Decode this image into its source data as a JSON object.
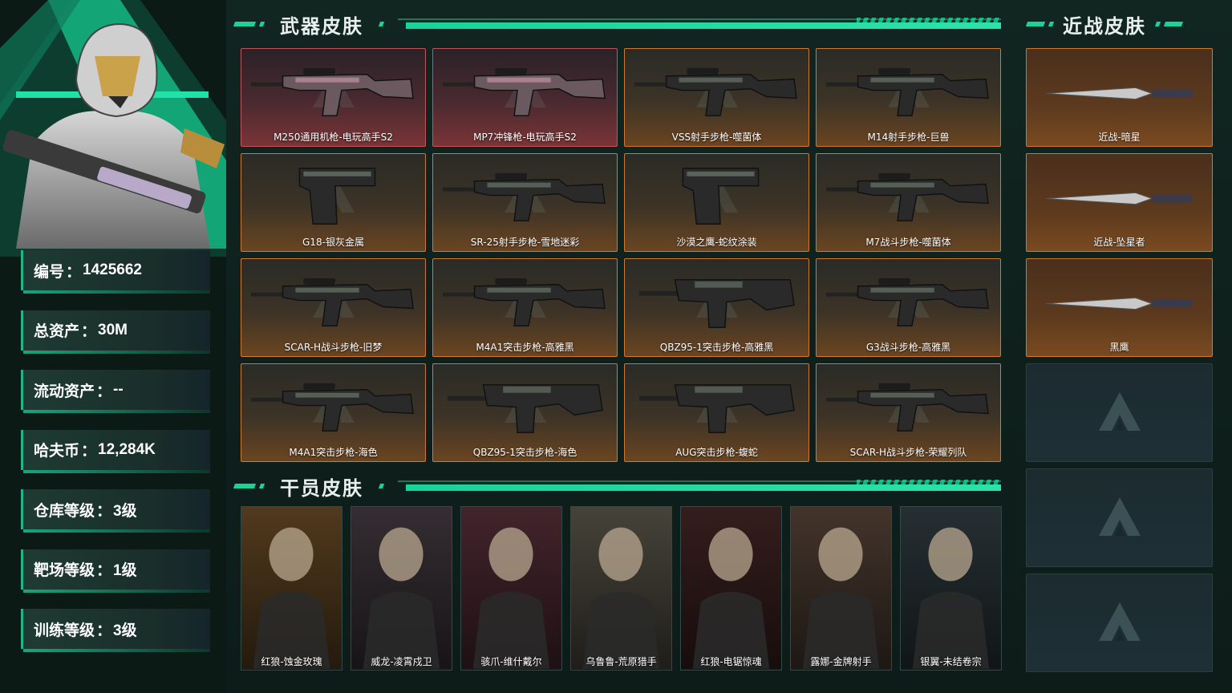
{
  "stats": [
    {
      "label": "编号",
      "value": "1425662"
    },
    {
      "label": "总资产",
      "value": "30M"
    },
    {
      "label": "流动资产",
      "value": "--"
    },
    {
      "label": "哈夫币",
      "value": "12,284K"
    },
    {
      "label": "仓库等级",
      "value": "3级"
    },
    {
      "label": "靶场等级",
      "value": "1级"
    },
    {
      "label": "训练等级",
      "value": "3级"
    }
  ],
  "stat_separator": "：",
  "sections": {
    "weapons_title": "武器皮肤",
    "operators_title": "干员皮肤",
    "melee_title": "近战皮肤"
  },
  "weapons": [
    {
      "name": "M250通用机枪-电玩高手S2",
      "rarity": "red",
      "icon": "lmg-icon"
    },
    {
      "name": "MP7冲锋枪-电玩高手S2",
      "rarity": "red",
      "icon": "smg-icon"
    },
    {
      "name": "VSS射手步枪-噬菌体",
      "rarity": "orange",
      "icon": "marksman-rifle-icon"
    },
    {
      "name": "M14射手步枪-巨兽",
      "rarity": "orange",
      "icon": "marksman-rifle-icon"
    },
    {
      "name": "G18-银灰金属",
      "rarity": "orange",
      "icon": "pistol-icon"
    },
    {
      "name": "SR-25射手步枪-雪地迷彩",
      "rarity": "orange",
      "icon": "marksman-rifle-icon"
    },
    {
      "name": "沙漠之鹰-蛇纹涂装",
      "rarity": "orange",
      "icon": "pistol-icon"
    },
    {
      "name": "M7战斗步枪-噬菌体",
      "rarity": "orange",
      "icon": "battle-rifle-icon"
    },
    {
      "name": "SCAR-H战斗步枪-旧梦",
      "rarity": "orange",
      "icon": "battle-rifle-icon"
    },
    {
      "name": "M4A1突击步枪-高雅黑",
      "rarity": "orange",
      "icon": "assault-rifle-icon"
    },
    {
      "name": "QBZ95-1突击步枪-高雅黑",
      "rarity": "orange",
      "icon": "bullpup-rifle-icon"
    },
    {
      "name": "G3战斗步枪-高雅黑",
      "rarity": "orange",
      "icon": "battle-rifle-icon"
    },
    {
      "name": "M4A1突击步枪-海色",
      "rarity": "orange",
      "icon": "assault-rifle-icon"
    },
    {
      "name": "QBZ95-1突击步枪-海色",
      "rarity": "orange",
      "icon": "bullpup-rifle-icon"
    },
    {
      "name": "AUG突击步枪-蝮蛇",
      "rarity": "orange",
      "icon": "bullpup-rifle-icon"
    },
    {
      "name": "SCAR-H战斗步枪-荣耀列队",
      "rarity": "orange",
      "icon": "battle-rifle-icon"
    }
  ],
  "melee": [
    {
      "name": "近战-暗星",
      "icon": "blade-icon"
    },
    {
      "name": "近战-坠星者",
      "icon": "blade-icon"
    },
    {
      "name": "黑鹰",
      "icon": "knife-icon"
    }
  ],
  "melee_empty_slots": 3,
  "operators": [
    {
      "name": "红狼-蚀金玫瑰",
      "tone": "#5a4020"
    },
    {
      "name": "威龙-凌霄戍卫",
      "tone": "#3a3238"
    },
    {
      "name": "骇爪-维什戴尔",
      "tone": "#4a2830"
    },
    {
      "name": "乌鲁鲁-荒原猎手",
      "tone": "#4e4a40"
    },
    {
      "name": "红狼-电锯惊魂",
      "tone": "#3a2020"
    },
    {
      "name": "露娜-金牌射手",
      "tone": "#4a3a30"
    },
    {
      "name": "银翼-未结卷宗",
      "tone": "#2a3438"
    }
  ],
  "colors": {
    "accent": "#17d49a",
    "rarity_orange": "#d4772e",
    "rarity_red": "#c8505a"
  }
}
